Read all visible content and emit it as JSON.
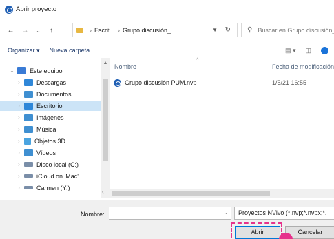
{
  "window": {
    "title": "Abrir proyecto"
  },
  "navigation": {
    "back": "←",
    "forward": "→",
    "recent": "⌄",
    "up": "↑",
    "breadcrumb": [
      "Escrit...",
      "Grupo discusión_..."
    ],
    "breadcrumb_sep": "›",
    "refresh": "↻",
    "search_placeholder": "Buscar en Grupo discusión_..."
  },
  "toolbar": {
    "organize": "Organizar ▾",
    "new_folder": "Nueva carpeta"
  },
  "sidebar": {
    "items": [
      {
        "label": "Este equipo",
        "icon": "computer-icon",
        "color": "#3a7bd5",
        "expanded": true
      },
      {
        "label": "Descargas",
        "icon": "downloads-icon",
        "color": "#2f87d8"
      },
      {
        "label": "Documentos",
        "icon": "documents-icon",
        "color": "#3f8fd1"
      },
      {
        "label": "Escritorio",
        "icon": "desktop-icon",
        "color": "#2f87d8",
        "selected": true
      },
      {
        "label": "Imágenes",
        "icon": "pictures-icon",
        "color": "#3f8fd1"
      },
      {
        "label": "Música",
        "icon": "music-icon",
        "color": "#3f8fd1"
      },
      {
        "label": "Objetos 3D",
        "icon": "objects-3d-icon",
        "color": "#4aa4e0"
      },
      {
        "label": "Vídeos",
        "icon": "videos-icon",
        "color": "#3f8fd1"
      },
      {
        "label": "Disco local (C:)",
        "icon": "drive-icon",
        "color": "#7a8ea8"
      },
      {
        "label": "iCloud on 'Mac'",
        "icon": "network-drive-icon",
        "color": "#7a8ea8"
      },
      {
        "label": "Carmen (Y:)",
        "icon": "network-drive-icon",
        "color": "#7a8ea8"
      }
    ]
  },
  "file_list": {
    "columns": {
      "name": "Nombre",
      "date": "Fecha de modificación"
    },
    "rows": [
      {
        "name": "Grupo discusión PUM.nvp",
        "date": "1/5/21 16:55"
      }
    ]
  },
  "footer": {
    "name_label": "Nombre:",
    "name_value": "",
    "filetype": "Proyectos NVivo (*.nvp;*.nvpx;*.",
    "open_button": "Abrir",
    "cancel_button": "Cancelar"
  },
  "colors": {
    "accent": "#0078d7",
    "highlight": "#e6328c",
    "selected_bg": "#cce4f7"
  }
}
